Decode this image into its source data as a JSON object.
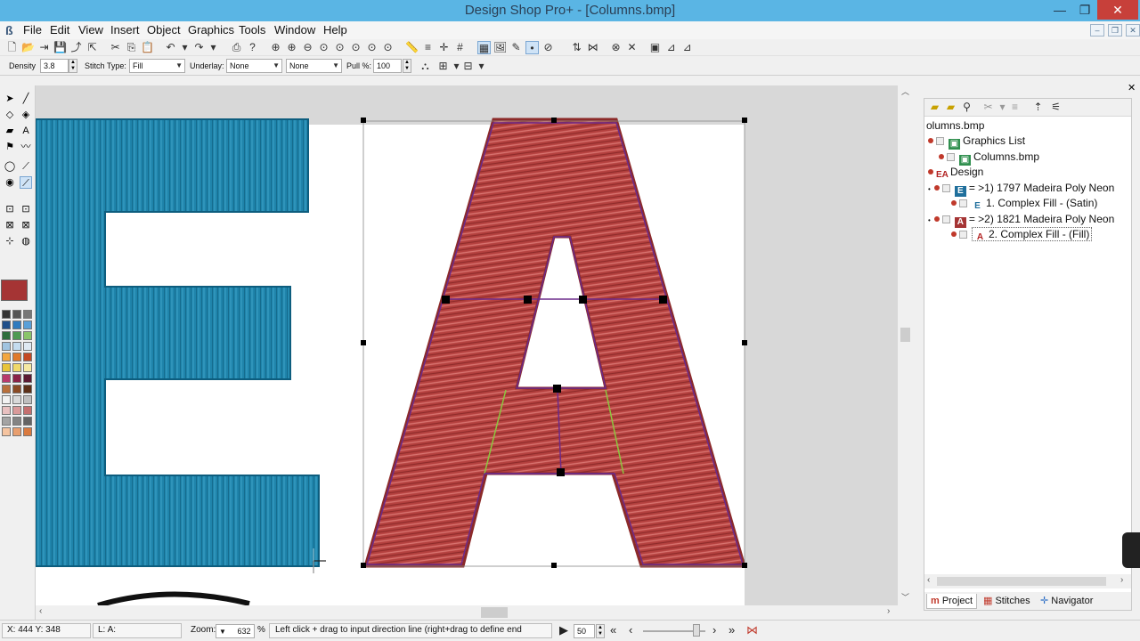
{
  "window": {
    "title": "Design Shop Pro+ - [Columns.bmp]",
    "controls": [
      "—",
      "❐",
      "✕"
    ]
  },
  "menu": [
    "File",
    "Edit",
    "View",
    "Insert",
    "Object",
    "Graphics",
    "Tools",
    "Window",
    "Help"
  ],
  "properties_bar": {
    "density_label": "Density",
    "density_value": "3.8",
    "stitch_type_label": "Stitch Type:",
    "stitch_type_value": "Fill",
    "underlay_label": "Underlay:",
    "underlay_value": "None",
    "underlay2_value": "None",
    "pull_label": "Pull %:",
    "pull_value": "100"
  },
  "colors": {
    "blue_thread": "#1f84ab",
    "red_thread": "#b5413f",
    "outline": "#6b2a8a",
    "current_color": "#a53434"
  },
  "palette": [
    "#333333",
    "#555555",
    "#777777",
    "#1f4f8a",
    "#2e7bbf",
    "#5aa0d8",
    "#2f6f3c",
    "#4f9a53",
    "#8ac46a",
    "#a0c4e0",
    "#c4dcef",
    "#dfe9f2",
    "#f2a640",
    "#e07a2b",
    "#c44a24",
    "#e8c43a",
    "#f0d96a",
    "#f5e9a3",
    "#b9396c",
    "#8a2247",
    "#5c1a33",
    "#b96f3a",
    "#8a4a24",
    "#5c3018",
    "#f2f2f2",
    "#d9d9d9",
    "#bfbfbf",
    "#e8c0c0",
    "#d99a9a",
    "#c46f6f",
    "#a4a4a4",
    "#848484",
    "#646464",
    "#f5c4a0",
    "#e89f6f",
    "#d97a3f"
  ],
  "tree": {
    "root_label": "olumns.bmp",
    "graphics_list": "Graphics List",
    "graphics_item": "Columns.bmp",
    "design": "Design",
    "thread1": "= >1) 1797 Madeira Poly Neon",
    "fill1": "1. Complex Fill - (Satin)",
    "thread2": "= >2) 1821 Madeira Poly Neon",
    "fill2": "2. Complex Fill - (Fill)"
  },
  "panel_tabs": [
    "Project",
    "Stitches",
    "Navigator"
  ],
  "status": {
    "coords": "X: 444  Y: 348",
    "layer": "L: A:",
    "zoom_label": "Zoom:",
    "zoom_value": "632",
    "zoom_unit": "%",
    "hint": "Left click + drag to input direction line (right+drag to define end",
    "stitch_step": "50"
  },
  "canvas_icons": [
    "cursor-cross-icon"
  ]
}
